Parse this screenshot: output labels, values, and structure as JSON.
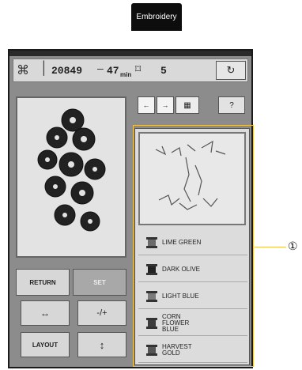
{
  "header": {
    "tab_label": "Embroidery"
  },
  "status": {
    "stitch_count": "20849",
    "time": "47",
    "time_unit": "min",
    "color_count": "5"
  },
  "buttons": {
    "return": "RETURN",
    "set": "SET",
    "layout": "LAYOUT",
    "move": "-/+"
  },
  "colors": [
    {
      "name": "LIME GREEN"
    },
    {
      "name": "DARK OLIVE"
    },
    {
      "name": "LIGHT BLUE"
    },
    {
      "name": "CORN FLOWER BLUE"
    },
    {
      "name": "HARVEST GOLD"
    }
  ],
  "callout": {
    "label": "①"
  }
}
